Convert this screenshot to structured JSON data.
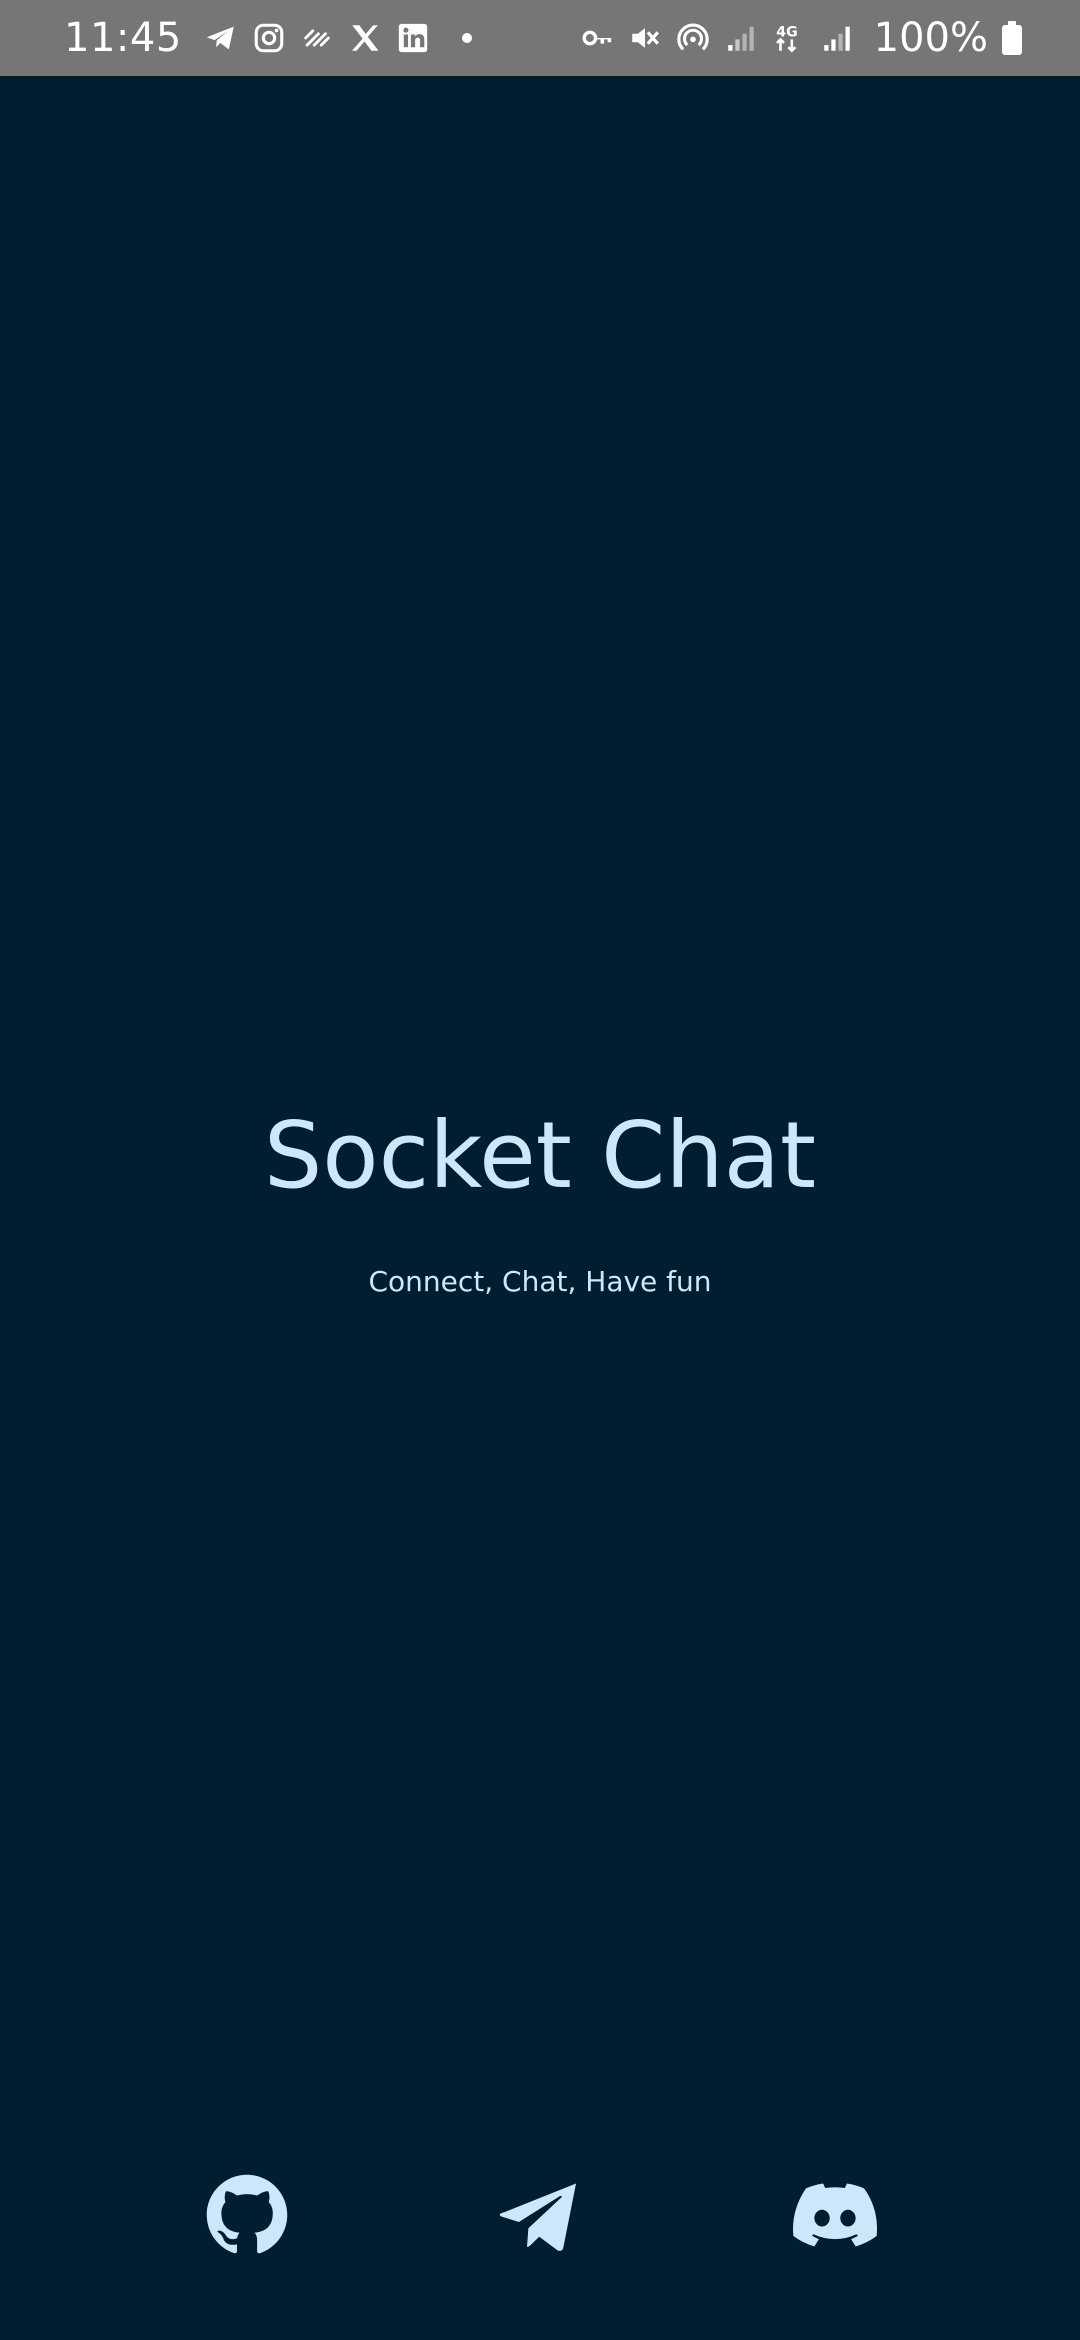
{
  "status_bar": {
    "time": "11:45",
    "left_icons": [
      "telegram-icon",
      "instagram-icon",
      "app-icon",
      "x-icon",
      "linkedin-icon",
      "dot"
    ],
    "right_icons": [
      "key-icon",
      "mute-icon",
      "hotspot-icon",
      "signal-icon",
      "4g-icon",
      "signal-icon"
    ],
    "network_label": "4G",
    "battery_percent": "100%"
  },
  "main": {
    "title": "Socket Chat",
    "subtitle": "Connect, Chat, Have fun"
  },
  "links": [
    {
      "name": "github",
      "icon": "github-icon"
    },
    {
      "name": "telegram",
      "icon": "telegram-icon"
    },
    {
      "name": "discord",
      "icon": "discord-icon"
    }
  ],
  "colors": {
    "background": "#011D30",
    "accent": "#CDE6FA",
    "status_bar": "#767676"
  }
}
